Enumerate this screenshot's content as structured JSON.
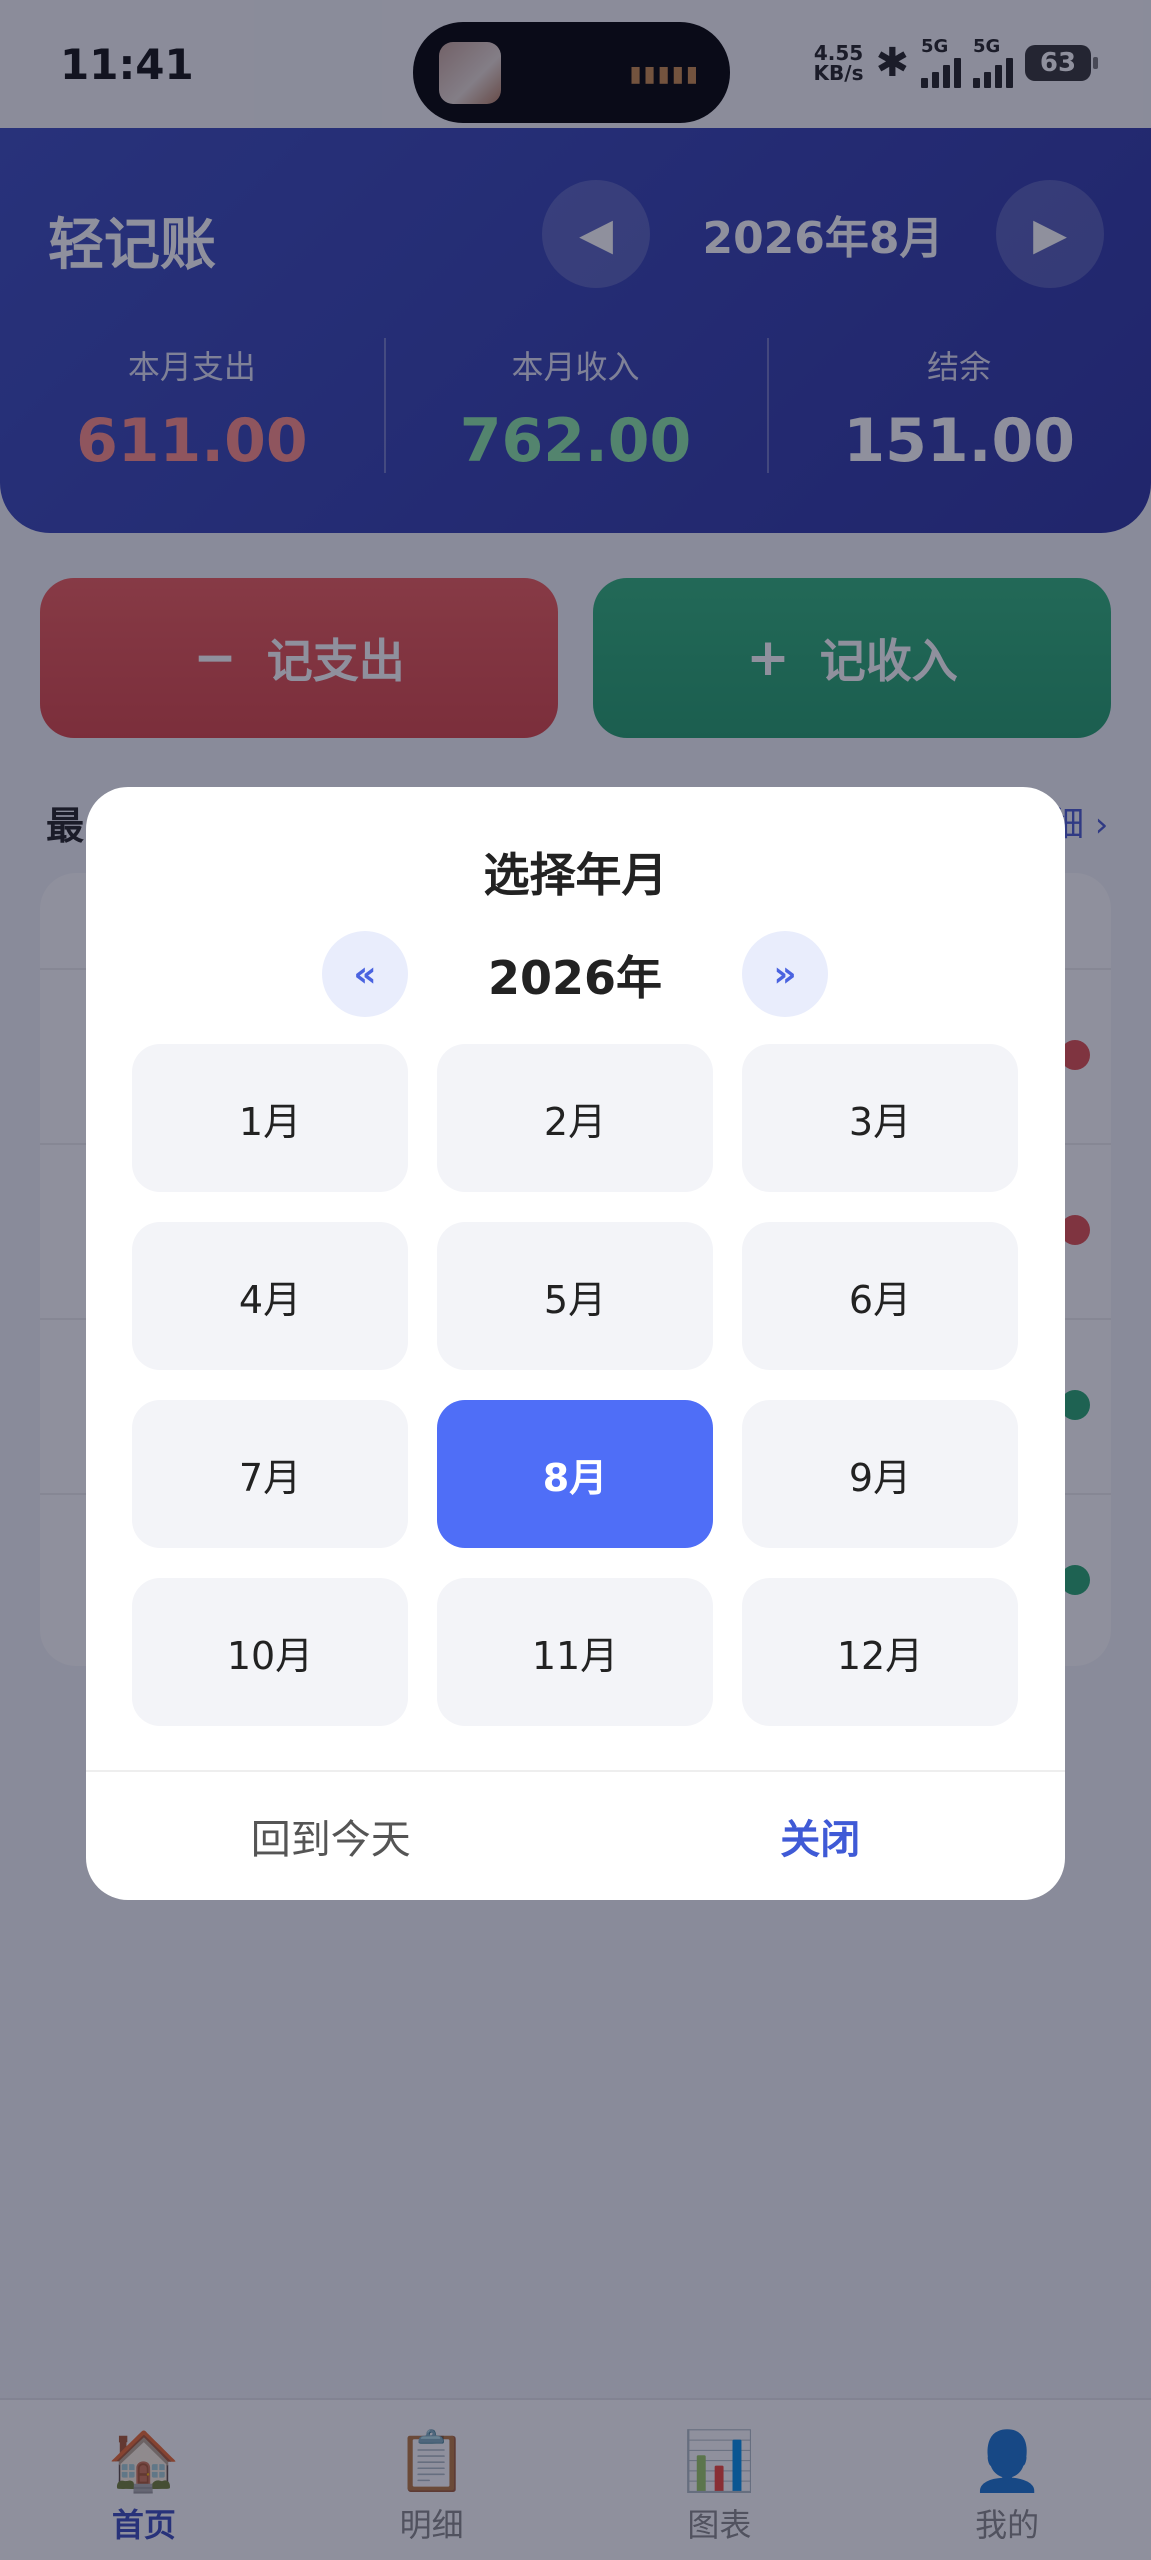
{
  "status_bar": {
    "time": "11:41",
    "net_speed_value": "4.55",
    "net_speed_unit": "KB/s",
    "signal1_tag": "5G",
    "signal2_tag": "5G",
    "battery": "63"
  },
  "header": {
    "app_title": "轻记账",
    "current_month": "2026年8月",
    "prev_icon": "◀",
    "next_icon": "▶",
    "summary": {
      "expense_label": "本月支出",
      "expense_value": "611.00",
      "income_label": "本月收入",
      "income_value": "762.00",
      "balance_label": "结余",
      "balance_value": "151.00"
    }
  },
  "actions": {
    "expense_sign": "−",
    "expense_label": "记支出",
    "income_sign": "+",
    "income_label": "记收入"
  },
  "recent": {
    "title_partial": "最",
    "more_partial": "细 ›"
  },
  "colors": {
    "header_bg": "#3a4bbd",
    "expense": "#e0504d",
    "income": "#28a870",
    "selected_month": "#4f6ef7"
  },
  "picker": {
    "title": "选择年月",
    "prev_year_icon": "«",
    "next_year_icon": "»",
    "year_label": "2026年",
    "months": [
      "1月",
      "2月",
      "3月",
      "4月",
      "5月",
      "6月",
      "7月",
      "8月",
      "9月",
      "10月",
      "11月",
      "12月"
    ],
    "selected_month": "8月",
    "today_button": "回到今天",
    "close_button": "关闭"
  },
  "bottom_nav": {
    "items": [
      {
        "icon": "🏠",
        "icon_name": "home-icon",
        "label": "首页",
        "active": true
      },
      {
        "icon": "📋",
        "icon_name": "clipboard-icon",
        "label": "明细",
        "active": false
      },
      {
        "icon": "📊",
        "icon_name": "chart-icon",
        "label": "图表",
        "active": false
      },
      {
        "icon": "👤",
        "icon_name": "user-icon",
        "label": "我的",
        "active": false
      }
    ]
  }
}
